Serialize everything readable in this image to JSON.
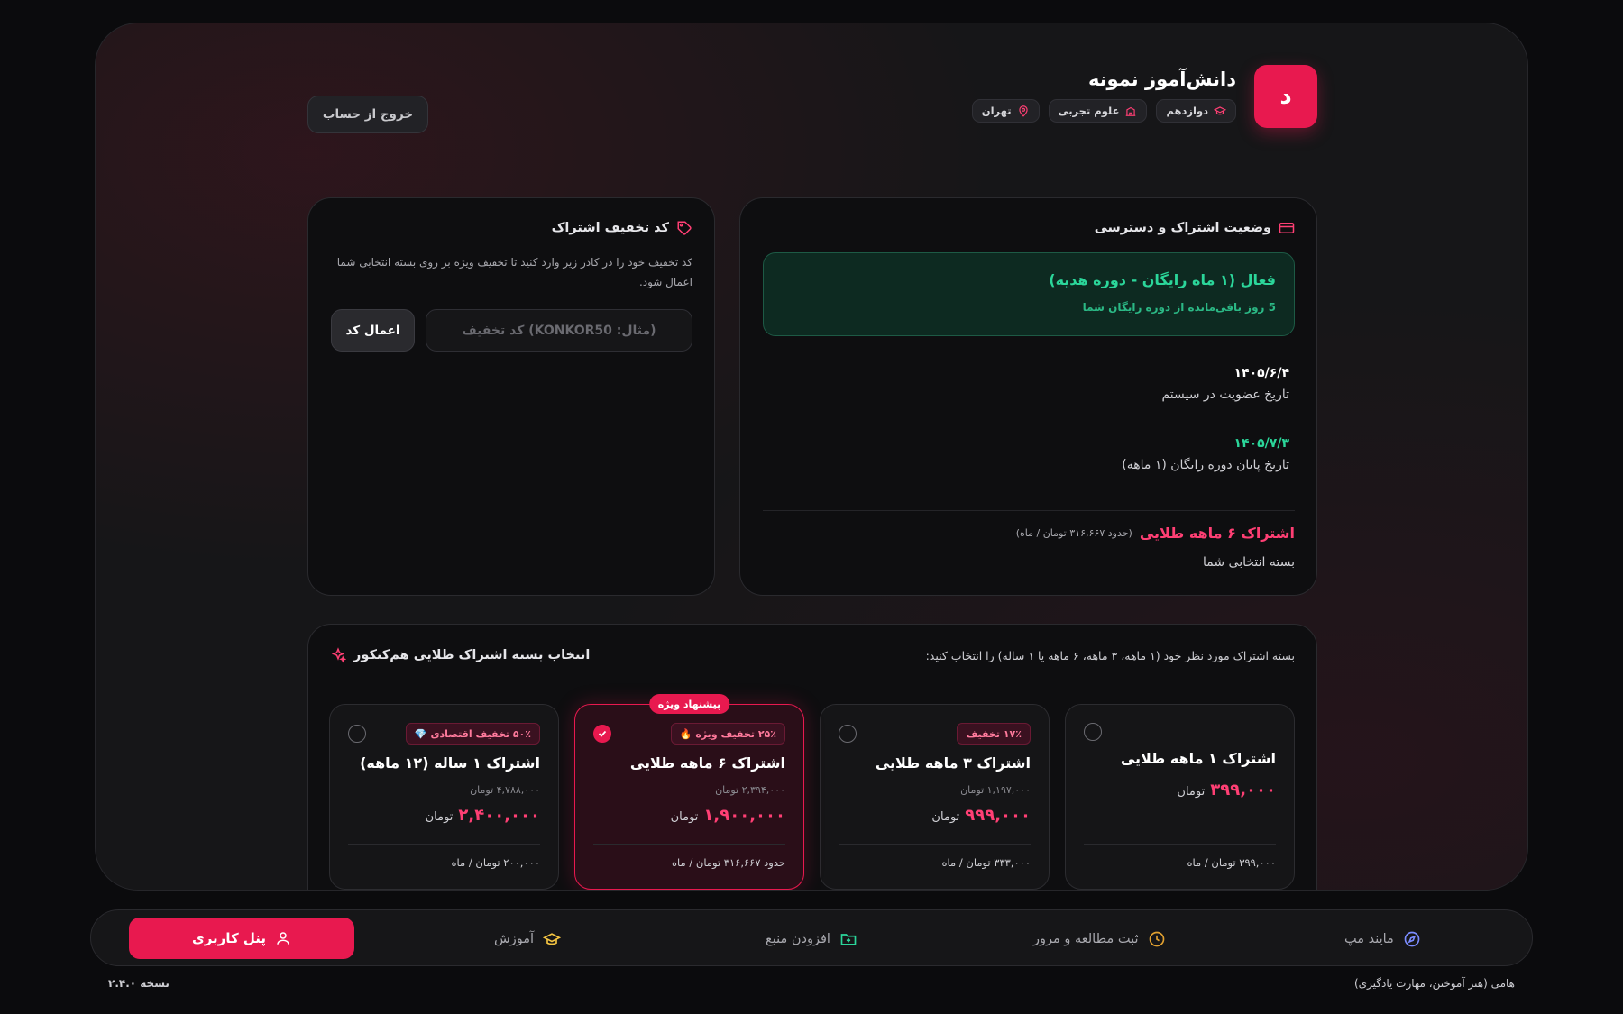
{
  "profile": {
    "avatar_letter": "د",
    "name": "دانش‌آموز نمونه",
    "chips": [
      {
        "label": "دوازدهم",
        "icon": "graduation-cap-icon"
      },
      {
        "label": "علوم تجربی",
        "icon": "school-icon"
      },
      {
        "label": "تهران",
        "icon": "map-pin-icon"
      }
    ],
    "logout_label": "خروج از حساب"
  },
  "status": {
    "title": "وضعیت اشتراک و دسترسی",
    "active_title": "فعال (۱ ماه رایگان - دوره هدیه)",
    "active_subtitle": "5 روز باقی‌مانده از دوره رایگان شما",
    "join_date": "۱۴۰۵/۶/۴",
    "join_label": "تاریخ عضویت در سیستم",
    "end_date": "۱۴۰۵/۷/۳",
    "end_label": "تاریخ پایان دوره رایگان (۱ ماهه)",
    "selected_plan": "اشتراک ۶ ماهه طلایی",
    "selected_plan_approx": "(حدود ۳۱۶,۶۶۷ تومان / ماه)",
    "selected_plan_label": "بسته انتخابی شما"
  },
  "discount": {
    "title": "کد تخفیف اشتراک",
    "description": "کد تخفیف خود را در کادر زیر وارد کنید تا تخفیف ویژه بر روی بسته انتخابی شما اعمال شود.",
    "placeholder": "(مثال: KONKOR50) کد تخفیف",
    "apply_label": "اعمال کد"
  },
  "plans_section": {
    "title": "انتخاب بسته اشتراک طلایی هم‌کنکور",
    "hint": "بسته اشتراک مورد نظر خود (۱ ماهه، ۳ ماهه، ۶ ماهه یا ۱ ساله) را انتخاب کنید:",
    "currency": "تومان",
    "plans": [
      {
        "title": "اشتراک ۱ ماهه طلایی",
        "price": "۳۹۹,۰۰۰",
        "old_price": "",
        "badge": "",
        "monthly": "۳۹۹,۰۰۰ تومان / ماه",
        "selected": false,
        "tag": ""
      },
      {
        "title": "اشتراک ۳ ماهه طلایی",
        "price": "۹۹۹,۰۰۰",
        "old_price": "۱,۱۹۷,۰۰۰ تومان",
        "badge": "۱۷٪ تخفیف",
        "badge_emoji": "",
        "monthly": "۳۳۳,۰۰۰ تومان / ماه",
        "selected": false,
        "tag": ""
      },
      {
        "title": "اشتراک ۶ ماهه طلایی",
        "price": "۱,۹۰۰,۰۰۰",
        "old_price": "۲,۳۹۴,۰۰۰ تومان",
        "badge": "۲۵٪ تخفیف ویژه",
        "badge_emoji": "🔥",
        "monthly": "حدود ۳۱۶,۶۶۷ تومان / ماه",
        "selected": true,
        "tag": "پیشنهاد ویژه"
      },
      {
        "title": "اشتراک ۱ ساله (۱۲ ماهه)",
        "price": "۲,۴۰۰,۰۰۰",
        "old_price": "۴,۷۸۸,۰۰۰ تومان",
        "badge": "۵۰٪ تخفیف اقتصادی",
        "badge_emoji": "💎",
        "monthly": "۲۰۰,۰۰۰ تومان / ماه",
        "selected": false,
        "tag": ""
      }
    ]
  },
  "nav": {
    "mindmap": "مایند مپ",
    "study_log": "ثبت مطالعه و مرور",
    "add_resource": "افزودن منبع",
    "education": "آموزش",
    "user_panel": "پنل کاربری"
  },
  "footer": {
    "version": "نسخه ۲.۴.۰",
    "tagline": "هامی (هنر آموختن، مهارت یادگیری)"
  },
  "colors": {
    "accent": "#e8194f",
    "active_green": "#2bd69a",
    "price_pink": "#ff3f74"
  }
}
